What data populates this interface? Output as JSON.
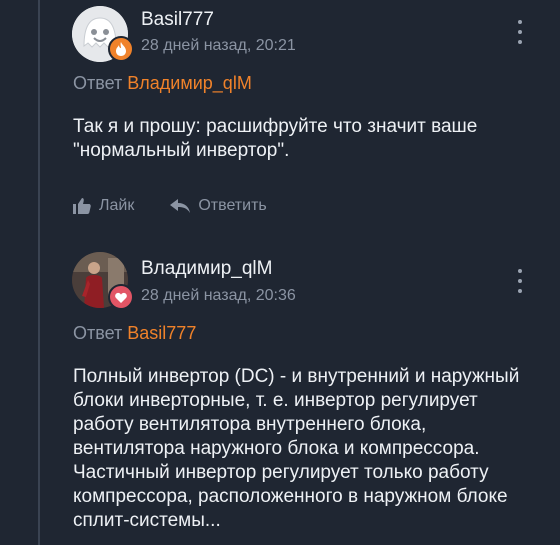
{
  "comments": [
    {
      "username": "Basil777",
      "time": "28 дней назад, 20:21",
      "reply_prefix": "Ответ",
      "reply_target": "Владимир_qlM",
      "text": "Так я и прошу: расшифруйте что значит ваше \"нормальный инвертор\".",
      "like_label": "Лайк",
      "reply_label": "Ответить",
      "badge_color": "#f0822a"
    },
    {
      "username": "Владимир_qlM",
      "time": "28 дней назад, 20:36",
      "reply_prefix": "Ответ",
      "reply_target": "Basil777",
      "text": "Полный инвертор (DC) - и внутренний и наружный блоки инверторные, т. е. инвертор регулирует работу вентилятора внутреннего блока, вентилятора наружного блока и компрессора. Частичный инвертор регулирует только работу компрессора, расположенного в наружном блоке сплит-системы...",
      "badge_color": "#e25565"
    }
  ],
  "colors": {
    "accent": "#f0822a",
    "background": "#1f2632",
    "muted": "#8b94a3"
  }
}
